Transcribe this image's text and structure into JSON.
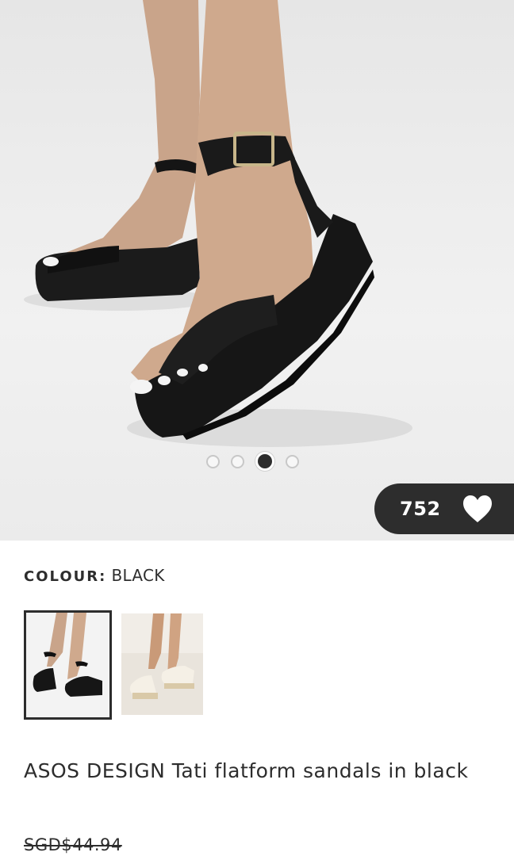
{
  "gallery": {
    "image_alt": "Black flatform sandals worn on feet",
    "slides": 4,
    "active_slide": 3
  },
  "save": {
    "count": "752",
    "icon": "heart-icon"
  },
  "colour": {
    "key": "COLOUR:",
    "value": "BLACK"
  },
  "variants": [
    {
      "name": "black",
      "selected": true
    },
    {
      "name": "beige",
      "selected": false
    }
  ],
  "product": {
    "title": "ASOS DESIGN Tati flatform sandals in black",
    "price": "SGD$44.94"
  },
  "colors": {
    "text": "#2d2d2d",
    "pill": "#2d2d2d"
  }
}
